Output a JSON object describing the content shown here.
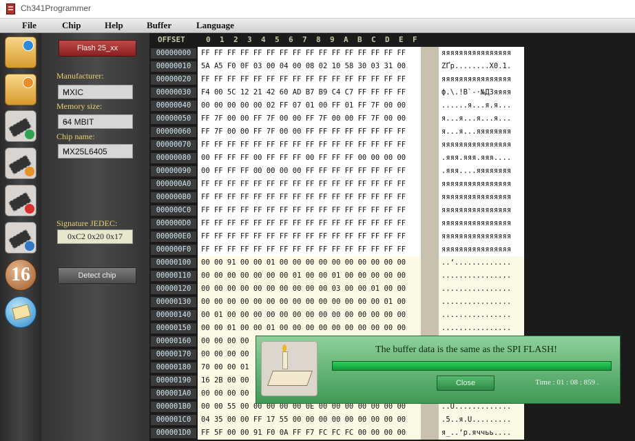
{
  "window": {
    "title": "Ch341Programmer"
  },
  "menu": [
    "File",
    "Chip",
    "Help",
    "Buffer",
    "Language"
  ],
  "toolbar_icons": [
    "open-folder-icon",
    "save-folder-icon",
    "read-chip-icon",
    "write-chip-icon",
    "erase-chip-icon",
    "verify-chip-icon",
    "number-16-icon",
    "about-scroll-icon"
  ],
  "toolbar_num_label": "16",
  "side": {
    "flash_button": "Flash 25_xx",
    "manufacturer_label": "Manufacturer:",
    "manufacturer_value": "MXIC",
    "memory_label": "Memory size:",
    "memory_value": "64 MBIT",
    "chip_label": "Chip name:",
    "chip_value": "MX25L6405",
    "signature_label": "Signature JEDEC:",
    "signature_value": "0xC2  0x20  0x17",
    "detect_button": "Detect chip"
  },
  "hex": {
    "offset_header": "OFFSET",
    "columns": [
      "0",
      "1",
      "2",
      "3",
      "4",
      "5",
      "6",
      "7",
      "8",
      "9",
      "A",
      "B",
      "C",
      "D",
      "E",
      "F"
    ],
    "rows": [
      {
        "offset": "00000000",
        "bytes": "FF FF FF FF FF FF FF FF FF FF FF FF FF FF FF FF",
        "ascii": "яяяяяяяяяяяяяяяя"
      },
      {
        "offset": "00000010",
        "bytes": "5A A5 F0 0F 03 00 04 00 08 02 10 58 30 03 31 00",
        "ascii": "ZҐр........X0.1."
      },
      {
        "offset": "00000020",
        "bytes": "FF FF FF FF FF FF FF FF FF FF FF FF FF FF FF FF",
        "ascii": "яяяяяяяяяяяяяяяя"
      },
      {
        "offset": "00000030",
        "bytes": "F4 00 5C 12 21 42 60 AD B7 B9 C4 C7 FF FF FF FF",
        "ascii": "ф.\\.!B`-·№ДЗяяяя"
      },
      {
        "offset": "00000040",
        "bytes": "00 00 00 00 00 02 FF 07 01 00 FF 01 FF 7F 00 00",
        "ascii": "......я...я.я..."
      },
      {
        "offset": "00000050",
        "bytes": "FF 7F 00 00 FF 7F 00 00 FF 7F 00 00 FF 7F 00 00",
        "ascii": "я...я...я...я..."
      },
      {
        "offset": "00000060",
        "bytes": "FF 7F 00 00 FF 7F 00 00 FF FF FF FF FF FF FF FF",
        "ascii": "я...я...яяяяяяяя"
      },
      {
        "offset": "00000070",
        "bytes": "FF FF FF FF FF FF FF FF FF FF FF FF FF FF FF FF",
        "ascii": "яяяяяяяяяяяяяяяя"
      },
      {
        "offset": "00000080",
        "bytes": "00 FF FF FF 00 FF FF FF 00 FF FF FF 00 00 00 00",
        "ascii": ".яяя.яяя.яяя...."
      },
      {
        "offset": "00000090",
        "bytes": "00 FF FF FF 00 00 00 00 FF FF FF FF FF FF FF FF",
        "ascii": ".яяя....яяяяяяяя"
      },
      {
        "offset": "000000A0",
        "bytes": "FF FF FF FF FF FF FF FF FF FF FF FF FF FF FF FF",
        "ascii": "яяяяяяяяяяяяяяяя"
      },
      {
        "offset": "000000B0",
        "bytes": "FF FF FF FF FF FF FF FF FF FF FF FF FF FF FF FF",
        "ascii": "яяяяяяяяяяяяяяяя"
      },
      {
        "offset": "000000C0",
        "bytes": "FF FF FF FF FF FF FF FF FF FF FF FF FF FF FF FF",
        "ascii": "яяяяяяяяяяяяяяяя"
      },
      {
        "offset": "000000D0",
        "bytes": "FF FF FF FF FF FF FF FF FF FF FF FF FF FF FF FF",
        "ascii": "яяяяяяяяяяяяяяяя"
      },
      {
        "offset": "000000E0",
        "bytes": "FF FF FF FF FF FF FF FF FF FF FF FF FF FF FF FF",
        "ascii": "яяяяяяяяяяяяяяяя"
      },
      {
        "offset": "000000F0",
        "bytes": "FF FF FF FF FF FF FF FF FF FF FF FF FF FF FF FF",
        "ascii": "яяяяяяяяяяяяяяяя"
      },
      {
        "offset": "00000100",
        "bytes": "00 00 91 00 00 01 00 00 00 00 00 00 00 00 00 00",
        "ascii": "..‘............."
      },
      {
        "offset": "00000110",
        "bytes": "00 00 00 00 00 00 00 01 00 00 01 00 00 00 00 00",
        "ascii": "................"
      },
      {
        "offset": "00000120",
        "bytes": "00 00 00 00 00 00 00 00 00 00 03 00 00 01 00 00",
        "ascii": "................"
      },
      {
        "offset": "00000130",
        "bytes": "00 00 00 00 00 00 00 00 00 00 00 00 00 00 01 00",
        "ascii": "................"
      },
      {
        "offset": "00000140",
        "bytes": "00 01 00 00 00 00 00 00 00 00 00 00 00 00 00 00",
        "ascii": "................"
      },
      {
        "offset": "00000150",
        "bytes": "00 00 01 00 00 01 00 00 00 00 00 00 00 00 00 00",
        "ascii": "................"
      },
      {
        "offset": "00000160",
        "bytes": "00 00 00 00",
        "ascii": ""
      },
      {
        "offset": "00000170",
        "bytes": "00 00 00 00",
        "ascii": ""
      },
      {
        "offset": "00000180",
        "bytes": "70 00 00 01",
        "ascii": ""
      },
      {
        "offset": "00000190",
        "bytes": "16 2B 00 00",
        "ascii": ""
      },
      {
        "offset": "000001A0",
        "bytes": "00 00 00 00",
        "ascii": ""
      },
      {
        "offset": "000001B0",
        "bytes": "00 00 55 00 00 00 00 00 0E 00 00 00 00 00 00 00",
        "ascii": "..U............."
      },
      {
        "offset": "000001C0",
        "bytes": "04 35 00 00 FF 17 55 00 00 00 00 00 00 00 00 00",
        "ascii": ".5..я.U........."
      },
      {
        "offset": "000001D0",
        "bytes": "FF 5F 00 00 91 F0 0A FF F7 FC FC FC 00 00 00 00",
        "ascii": "я_..‘р.яччьь...."
      }
    ]
  },
  "dialog": {
    "message": "The buffer data is the same as the SPI FLASH!",
    "close_label": "Close",
    "time": "Time :  01 : 08 : 859 .",
    "progress": 1.0
  }
}
